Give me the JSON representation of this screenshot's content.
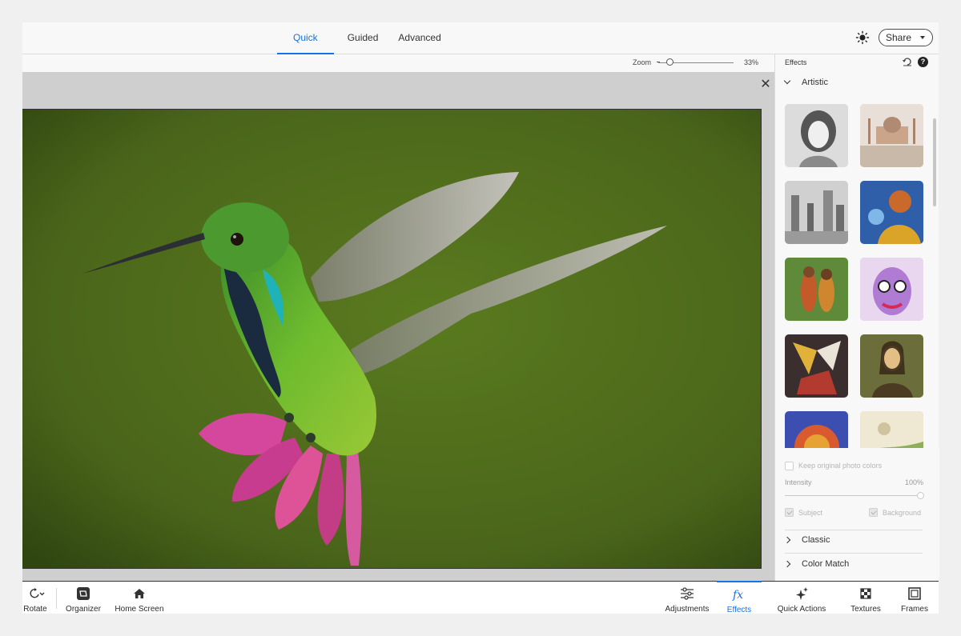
{
  "top": {
    "tabs": [
      {
        "label": "Quick",
        "active": true
      },
      {
        "label": "Guided",
        "active": false
      },
      {
        "label": "Advanced",
        "active": false
      }
    ],
    "share_label": "Share"
  },
  "zoom": {
    "label": "Zoom",
    "value": "33%",
    "level_fraction": 0.33
  },
  "panel": {
    "title": "Effects",
    "sections": {
      "artistic": "Artistic",
      "classic": "Classic",
      "color_match": "Color Match"
    },
    "options": {
      "keep_colors": "Keep original photo colors",
      "intensity_label": "Intensity",
      "intensity_value": "100%",
      "subject": "Subject",
      "background": "Background"
    }
  },
  "bottom": {
    "rotate": "Rotate",
    "organizer": "Organizer",
    "home": "Home Screen",
    "adjustments": "Adjustments",
    "effects": "Effects",
    "quick_actions": "Quick Actions",
    "textures": "Textures",
    "frames": "Frames"
  },
  "colors": {
    "accent": "#1473e6",
    "canvas_bg": "#cfcfcf",
    "photo_bg": "#4f6a1a"
  }
}
